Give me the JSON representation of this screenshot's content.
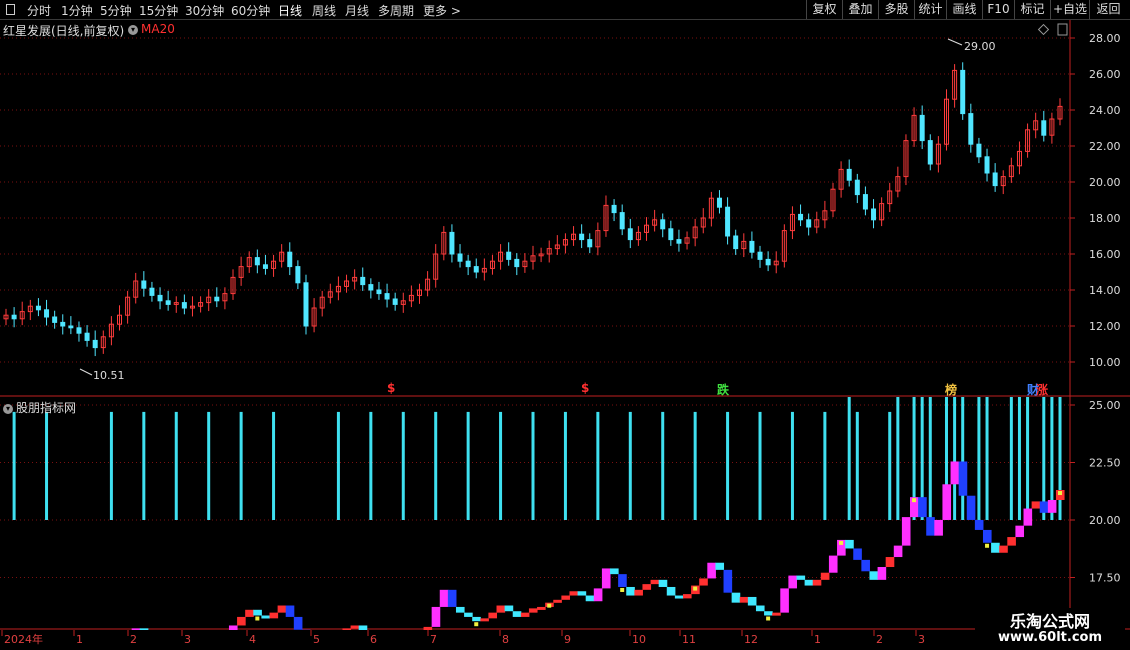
{
  "toolbar": {
    "periods": [
      "分时",
      "1分钟",
      "5分钟",
      "15分钟",
      "30分钟",
      "60分钟",
      "日线",
      "周线",
      "月线",
      "多周期",
      "更多 >"
    ],
    "active_period": "日线",
    "actions": [
      "复权",
      "叠加",
      "多股",
      "统计",
      "画线",
      "F10",
      "标记",
      "+自选",
      "返回"
    ]
  },
  "main_chart": {
    "stock_title": "红星发展(日线,前复权)",
    "indicator": "MA20",
    "y_ticks": [
      "28.00",
      "26.00",
      "24.00",
      "22.00",
      "20.00",
      "18.00",
      "16.00",
      "14.00",
      "12.00",
      "10.00"
    ],
    "high_label": "29.00",
    "low_label": "10.51",
    "signals": [
      {
        "text": "$",
        "color": "#ff3030"
      },
      {
        "text": "$",
        "color": "#ff3030"
      },
      {
        "text": "跌",
        "color": "#40e040"
      },
      {
        "text": "榜",
        "color": "#f0c040"
      },
      {
        "text": "财",
        "color": "#4080ff"
      },
      {
        "text": "涨",
        "color": "#ff3030"
      }
    ]
  },
  "sub_chart": {
    "title": "股朋指标网",
    "y_ticks": [
      "25.00",
      "22.50",
      "20.00",
      "17.50",
      "15.00"
    ]
  },
  "x_axis": {
    "labels": [
      "2024年",
      "1",
      "2",
      "3",
      "4",
      "5",
      "6",
      "7",
      "8",
      "9",
      "10",
      "11",
      "12",
      "1",
      "2",
      "3"
    ]
  },
  "watermark": {
    "title": "乐淘公式网",
    "url": "www.60lt.com"
  },
  "chart_data": {
    "type": "candlestick",
    "price_range": [
      9.6,
      29.6
    ],
    "high": 29.0,
    "low": 10.51,
    "close_series": [
      12.6,
      12.4,
      12.8,
      13.1,
      12.9,
      12.5,
      12.2,
      12.0,
      11.9,
      11.6,
      11.2,
      10.8,
      11.4,
      12.1,
      12.6,
      13.6,
      14.5,
      14.1,
      13.7,
      13.4,
      13.2,
      13.3,
      13.0,
      13.1,
      13.3,
      13.6,
      13.4,
      13.8,
      14.7,
      15.3,
      15.8,
      15.4,
      15.2,
      15.6,
      16.1,
      15.3,
      14.4,
      12.0,
      13.0,
      13.6,
      13.9,
      14.2,
      14.5,
      14.7,
      14.3,
      14.0,
      13.8,
      13.5,
      13.2,
      13.4,
      13.7,
      14.0,
      14.6,
      16.0,
      17.2,
      16.0,
      15.6,
      15.3,
      15.0,
      15.2,
      15.6,
      16.1,
      15.7,
      15.3,
      15.6,
      15.9,
      16.0,
      16.3,
      16.5,
      16.8,
      17.1,
      16.8,
      16.4,
      17.3,
      18.7,
      18.3,
      17.4,
      16.8,
      17.2,
      17.6,
      17.9,
      17.4,
      16.8,
      16.6,
      16.9,
      17.5,
      18.0,
      19.1,
      18.6,
      17.0,
      16.3,
      16.7,
      16.1,
      15.7,
      15.4,
      15.6,
      17.3,
      18.2,
      17.9,
      17.5,
      17.9,
      18.4,
      19.6,
      20.7,
      20.1,
      19.3,
      18.5,
      17.9,
      18.8,
      19.5,
      20.3,
      22.3,
      23.7,
      22.3,
      21.0,
      22.1,
      24.6,
      26.2,
      23.8,
      22.1,
      21.4,
      20.5,
      19.8,
      20.3,
      20.9,
      21.7,
      22.9,
      23.4,
      22.6,
      23.5,
      24.2
    ]
  }
}
